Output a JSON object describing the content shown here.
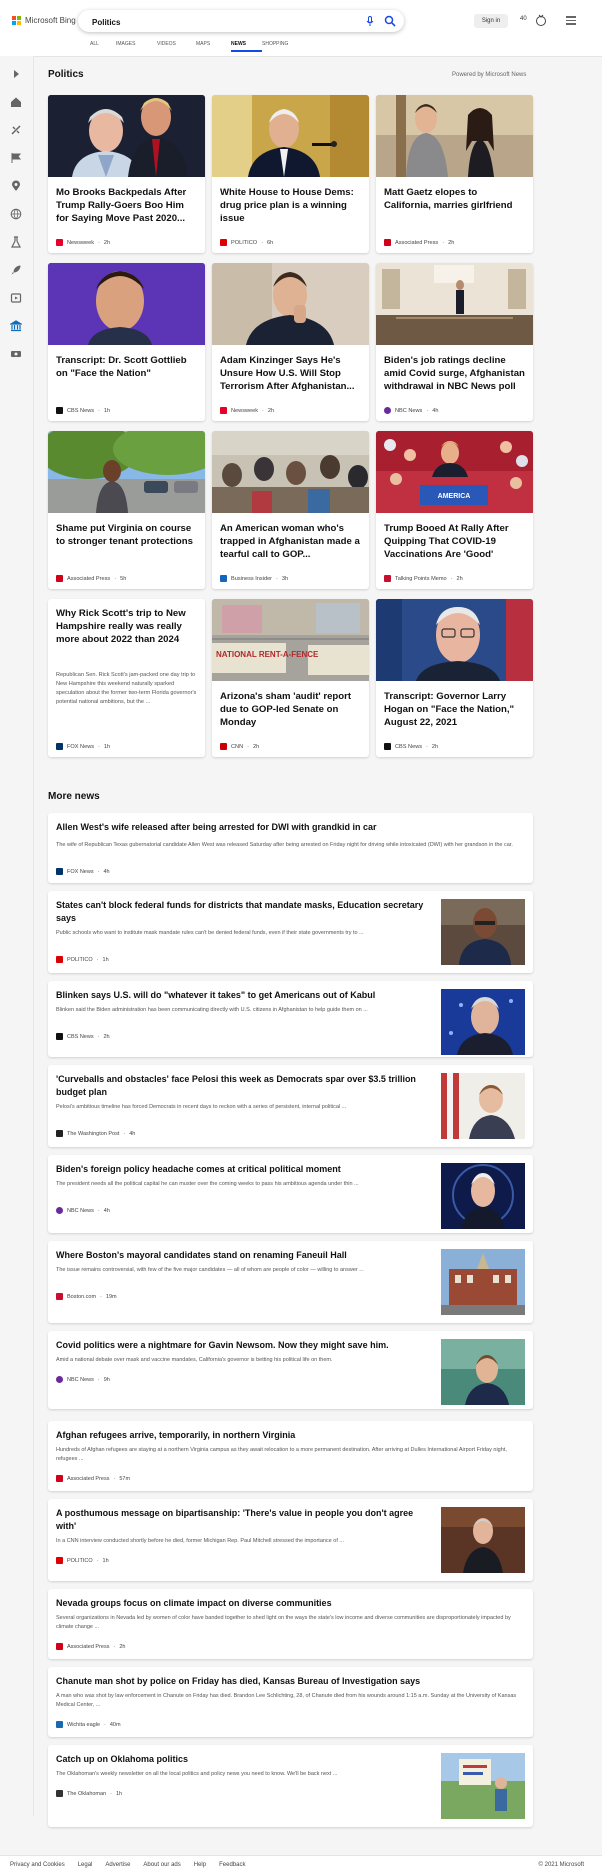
{
  "header": {
    "brand": "Microsoft Bing",
    "search_value": "Politics",
    "signin": "Sign in",
    "points": "40"
  },
  "tabs": [
    "ALL",
    "IMAGES",
    "VIDEOS",
    "MAPS",
    "NEWS",
    "SHOPPING"
  ],
  "active_tab": "NEWS",
  "sidebar_icons": [
    "expand-icon",
    "home-icon",
    "sports-icon",
    "flag-icon",
    "location-icon",
    "globe-icon",
    "science-icon",
    "rocket-icon",
    "entertainment-icon",
    "politics-icon",
    "money-icon"
  ],
  "section": {
    "title": "Politics",
    "powered": "Powered by Microsoft News"
  },
  "cards": [
    {
      "title": "Mo Brooks Backpedals After Trump Rally-Goers Boo Him for Saying Move Past 2020...",
      "source": "Newsweek",
      "time": "2h"
    },
    {
      "title": "White House to House Dems: drug price plan is a winning issue",
      "source": "POLITICO",
      "time": "6h"
    },
    {
      "title": "Matt Gaetz elopes to California, marries girlfriend",
      "source": "Associated Press",
      "time": "2h"
    },
    {
      "title": "Transcript: Dr. Scott Gottlieb on \"Face the Nation\"",
      "source": "CBS News",
      "time": "1h"
    },
    {
      "title": "Adam Kinzinger Says He's Unsure How U.S. Will Stop Terrorism After Afghanistan...",
      "source": "Newsweek",
      "time": "2h"
    },
    {
      "title": "Biden's job ratings decline amid Covid surge, Afghanistan withdrawal in NBC News poll",
      "source": "NBC News",
      "time": "4h"
    },
    {
      "title": "Shame put Virginia on course to stronger tenant protections",
      "source": "Associated Press",
      "time": "5h"
    },
    {
      "title": "An American woman who's trapped in Afghanistan made a tearful call to GOP...",
      "source": "Business Insider",
      "time": "3h"
    },
    {
      "title": "Trump Booed At Rally After Quipping That COVID-19 Vaccinations Are 'Good'",
      "source": "Talking Points Memo",
      "time": "2h"
    },
    {
      "title": "Why Rick Scott's trip to New Hampshire really was really more about 2022 than 2024",
      "snippet": "Republican Sen. Rick Scott's jam-packed one day trip to New Hampshire this weekend naturally sparked speculation about the former two-term Florida governor's potential national ambitions, but the ...",
      "source": "FOX News",
      "time": "1h"
    },
    {
      "title": "Arizona's sham 'audit' report due to GOP-led Senate on Monday",
      "source": "CNN",
      "time": "2h"
    },
    {
      "title": "Transcript: Governor Larry Hogan on \"Face the Nation,\" August 22, 2021",
      "source": "CBS News",
      "time": "2h"
    }
  ],
  "image_text": {
    "sign_america": "AMERICA",
    "national_fence": "NATIONAL RENT-A-FENCE"
  },
  "more_news": {
    "title": "More news",
    "items": [
      {
        "title": "Allen West's wife released after being arrested for DWI with grandkid in car",
        "snippet": "The wife of Republican Texas gubernatorial candidate Allen West was released Saturday after being arrested on Friday night for driving while intoxicated (DWI) with her grandson in the car.",
        "source": "FOX News",
        "time": "4h"
      },
      {
        "title": "States can't block federal funds for districts that mandate masks, Education secretary says",
        "snippet": "Public schools who want to institute mask mandate rules can't be denied federal funds, even if their state governments try to ...",
        "source": "POLITICO",
        "time": "1h"
      },
      {
        "title": "Blinken says U.S. will do \"whatever it takes\" to get Americans out of Kabul",
        "snippet": "Blinken said the Biden administration has been communicating directly with U.S. citizens in Afghanistan to help guide them on ...",
        "source": "CBS News",
        "time": "2h"
      },
      {
        "title": "'Curveballs and obstacles' face Pelosi this week as Democrats spar over $3.5 trillion budget plan",
        "snippet": "Pelosi's ambitious timeline has forced Democrats in recent days to reckon with a series of persistent, internal political ...",
        "source": "The Washington Post",
        "time": "4h"
      },
      {
        "title": "Biden's foreign policy headache comes at critical political moment",
        "snippet": "The president needs all the political capital he can muster over the coming weeks to pass his ambitious agenda under thin ...",
        "source": "NBC News",
        "time": "4h"
      },
      {
        "title": "Where Boston's mayoral candidates stand on renaming Faneuil Hall",
        "snippet": "The issue remains controversial, with few of the five major candidates — all of whom are people of color — willing to answer ...",
        "source": "Boston.com",
        "time": "19m"
      },
      {
        "title": "Covid politics were a nightmare for Gavin Newsom. Now they might save him.",
        "snippet": "Amid a national debate over mask and vaccine mandates, California's governor is betting his political life on them.",
        "source": "NBC News",
        "time": "9h"
      },
      {
        "title": "Afghan refugees arrive, temporarily, in northern Virginia",
        "snippet": "Hundreds of Afghan refugees are staying at a northern Virginia campus as they await relocation to a more permanent destination. After arriving at Dulles International Airport Friday night, refugees ...",
        "source": "Associated Press",
        "time": "57m"
      },
      {
        "title": "A posthumous message on bipartisanship: 'There's value in people you don't agree with'",
        "snippet": "In a CNN interview conducted shortly before he died, former Michigan Rep. Paul Mitchell stressed the importance of ...",
        "source": "POLITICO",
        "time": "1h"
      },
      {
        "title": "Nevada groups focus on climate impact on diverse communities",
        "snippet": "Several organizations in Nevada led by women of color have banded together to shed light on the ways the state's low income and diverse communities are disproportionately impacted by climate change ...",
        "source": "Associated Press",
        "time": "2h"
      },
      {
        "title": "Chanute man shot by police on Friday has died, Kansas Bureau of Investigation says",
        "snippet": "A man who was shot by law enforcement in Chanute on Friday has died. Brandon Lee Schlichting, 28, of Chanute died from his wounds around 1:15 a.m. Sunday at the University of Kansas Medical Center, ...",
        "source": "Wichita eagle",
        "time": "40m"
      },
      {
        "title": "Catch up on Oklahoma politics",
        "snippet": "The Oklahoman's weekly newsletter on all the local politics and policy news you need to know.  We'll be back next ...",
        "source": "The Oklahoman",
        "time": "1h"
      }
    ]
  },
  "footer": {
    "links": [
      "Privacy and Cookies",
      "Legal",
      "Advertise",
      "About our ads",
      "Help",
      "Feedback"
    ],
    "copyright": "© 2021 Microsoft"
  },
  "colors": {
    "accent": "#174ae4",
    "brand_red": "#f25022",
    "brand_green": "#7fba00",
    "brand_blue": "#00a4ef",
    "brand_yellow": "#ffb900"
  }
}
